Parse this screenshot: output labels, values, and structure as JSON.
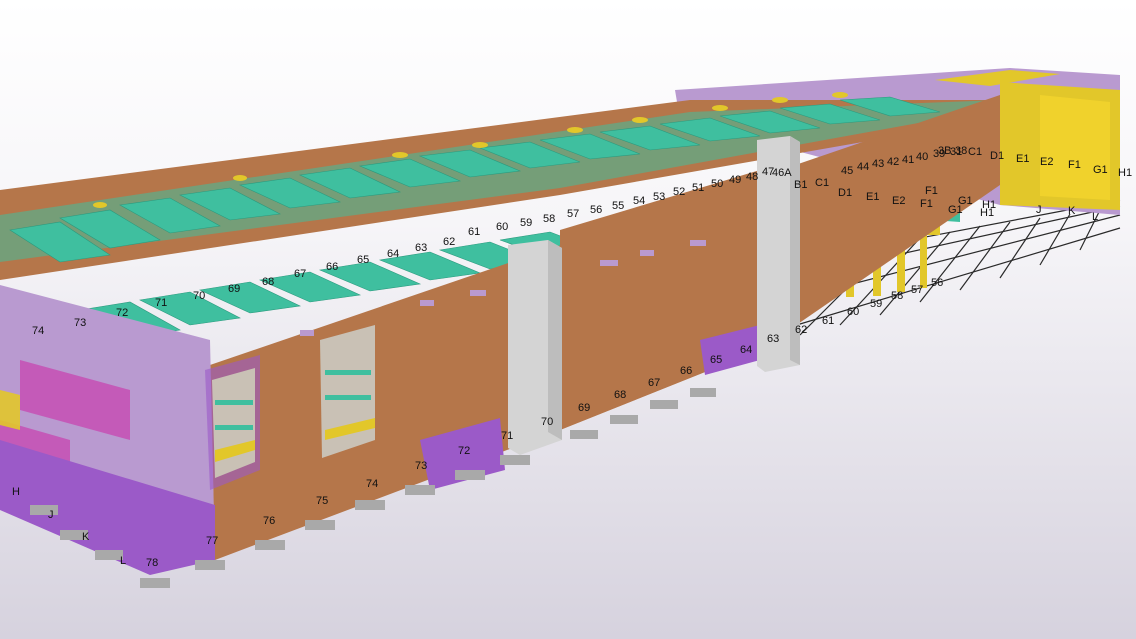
{
  "colors": {
    "background_top": "#ffffff",
    "background_bottom": "#d8d4e0",
    "wall_brown": "#b5764a",
    "wall_brown_dark": "#9c6440",
    "wall_lilac": "#b99ad0",
    "wall_magenta": "#c45ab8",
    "wall_purple": "#9b5ac8",
    "roof_teal": "#3fbf9f",
    "roof_yellow": "#e2c72a",
    "column_gray": "#d4d4d4",
    "foundation_gray": "#a9a9a9",
    "grid_line": "#2a2a2a"
  },
  "grid_labels": {
    "top_front": [
      "61",
      "60",
      "59",
      "58",
      "57",
      "56",
      "55",
      "54",
      "53",
      "52",
      "51",
      "50",
      "49",
      "48",
      "47",
      "46A"
    ],
    "top_left": [
      "74",
      "73",
      "72",
      "71",
      "70",
      "69",
      "68",
      "67",
      "66",
      "65",
      "64",
      "63",
      "62"
    ],
    "lower_row": [
      "78",
      "77",
      "76",
      "75",
      "74",
      "73",
      "72",
      "71",
      "70",
      "69",
      "68",
      "67",
      "66",
      "65",
      "64",
      "63",
      "62",
      "61",
      "60",
      "59",
      "58",
      "57",
      "56"
    ],
    "left_letters": [
      "H",
      "J",
      "K",
      "L"
    ],
    "right_block": [
      "B1",
      "C1",
      "D1",
      "E1",
      "E2",
      "F1",
      "G1",
      "H1",
      "3B",
      "31",
      "C1",
      "D1",
      "E1",
      "E2",
      "F1",
      "F1",
      "G1",
      "G1",
      "H1",
      "H1",
      "J",
      "K",
      "L"
    ],
    "top_cluster": [
      "45",
      "44",
      "43",
      "42",
      "41",
      "40",
      "39",
      "38"
    ]
  }
}
